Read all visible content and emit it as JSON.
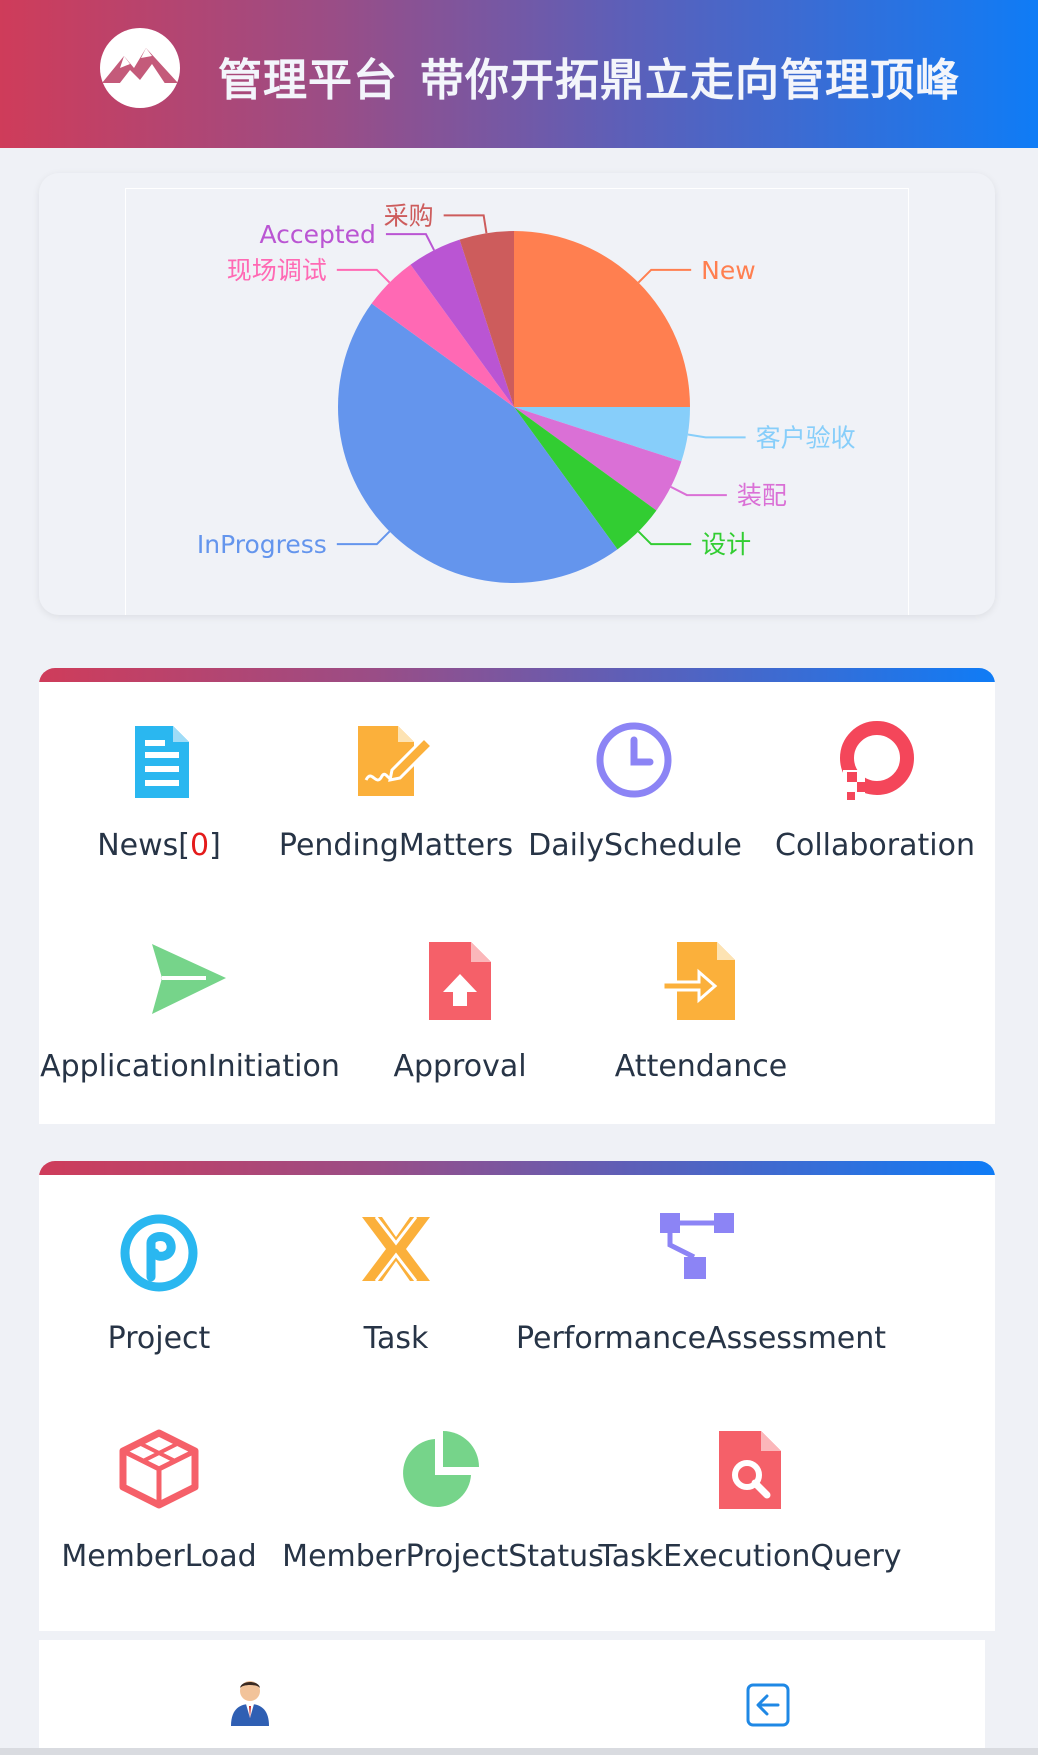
{
  "header": {
    "title": "管理平台",
    "slogan": "带你开拓鼎立走向管理顶峰"
  },
  "chart_data": {
    "type": "pie",
    "slices": [
      {
        "label": "New",
        "value": 25,
        "color": "#ff7f50"
      },
      {
        "label": "客户验收",
        "value": 5,
        "color": "#87cefa"
      },
      {
        "label": "装配",
        "value": 5,
        "color": "#da70d6"
      },
      {
        "label": "设计",
        "value": 5,
        "color": "#32cd32"
      },
      {
        "label": "InProgress",
        "value": 45,
        "color": "#6495ed"
      },
      {
        "label": "现场调试",
        "value": 5,
        "color": "#ff69b4"
      },
      {
        "label": "Accepted",
        "value": 5,
        "color": "#ba55d3"
      },
      {
        "label": "采购",
        "value": 5,
        "color": "#cd5c5c"
      }
    ]
  },
  "panel1": {
    "tiles": [
      {
        "label": "News[",
        "badge": "0",
        "suffix": "]",
        "icon": "document-icon"
      },
      {
        "label": "PendingMatters",
        "icon": "signature-file-icon"
      },
      {
        "label": "DailySchedule",
        "icon": "clock-icon"
      },
      {
        "label": "Collaboration",
        "icon": "debian-swirl-icon"
      },
      {
        "label": "ApplicationInitiation",
        "icon": "send-icon"
      },
      {
        "label": "Approval",
        "icon": "file-upload-icon"
      },
      {
        "label": "Attendance",
        "icon": "file-import-icon"
      }
    ]
  },
  "panel2": {
    "tiles": [
      {
        "label": "Project",
        "icon": "project-p-icon"
      },
      {
        "label": "Task",
        "icon": "cross-task-icon"
      },
      {
        "label": "PerformanceAssessment",
        "icon": "hierarchy-icon"
      },
      {
        "label": "MemberLoad",
        "icon": "box-3d-icon"
      },
      {
        "label": "MemberProjectStatus",
        "icon": "pie-icon"
      },
      {
        "label": "TaskExecutionQuery",
        "icon": "file-search-icon"
      }
    ]
  },
  "bottom_nav": {
    "items": [
      {
        "icon": "user-avatar-icon"
      },
      {
        "icon": "logout-icon"
      }
    ]
  }
}
